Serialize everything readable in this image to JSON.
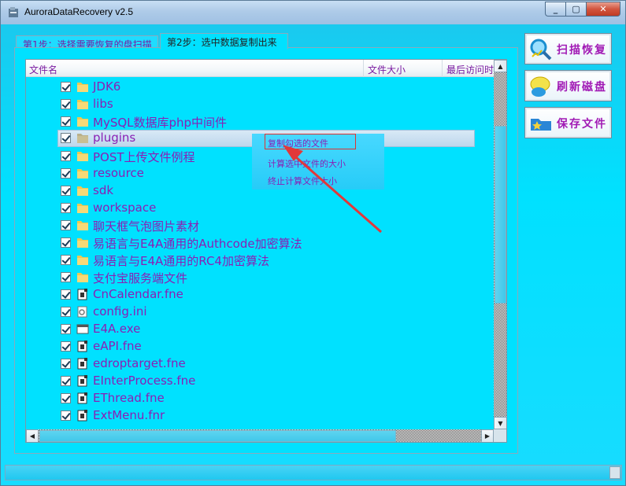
{
  "window": {
    "title": "AuroraDataRecovery v2.5",
    "min_label": "_",
    "max_label": "▢",
    "close_label": "✕"
  },
  "tabs": [
    {
      "label": "第1步：选择需要恢复的盘扫描"
    },
    {
      "label": "第2步：选中数据复制出来"
    }
  ],
  "list": {
    "columns": [
      "文件名",
      "文件大小",
      "最后访问时间"
    ],
    "rows": [
      {
        "name": "JDK6",
        "type": "folder"
      },
      {
        "name": "libs",
        "type": "folder"
      },
      {
        "name": "MySQL数据库php中间件",
        "type": "folder"
      },
      {
        "name": "plugins",
        "type": "folder"
      },
      {
        "name": "POST上传文件例程",
        "type": "folder"
      },
      {
        "name": "resource",
        "type": "folder"
      },
      {
        "name": "sdk",
        "type": "folder"
      },
      {
        "name": "workspace",
        "type": "folder"
      },
      {
        "name": "聊天框气泡图片素材",
        "type": "folder"
      },
      {
        "name": "易语言与E4A通用的Authcode加密算法",
        "type": "folder"
      },
      {
        "name": "易语言与E4A通用的RC4加密算法",
        "type": "folder"
      },
      {
        "name": "支付宝服务端文件",
        "type": "folder"
      },
      {
        "name": "CnCalendar.fne",
        "type": "fne"
      },
      {
        "name": "config.ini",
        "type": "ini"
      },
      {
        "name": "E4A.exe",
        "type": "exe"
      },
      {
        "name": "eAPI.fne",
        "type": "fne"
      },
      {
        "name": "edroptarget.fne",
        "type": "fne"
      },
      {
        "name": "EInterProcess.fne",
        "type": "fne"
      },
      {
        "name": "EThread.fne",
        "type": "fne"
      },
      {
        "name": "ExtMenu.fnr",
        "type": "fne"
      }
    ]
  },
  "context_menu": {
    "items": [
      "复制勾选的文件",
      "计算选中文件的大小",
      "终止计算文件大小"
    ]
  },
  "side_buttons": [
    {
      "label": "扫描恢复",
      "icon": "magnifier-icon"
    },
    {
      "label": "刷新磁盘",
      "icon": "bubble-icon"
    },
    {
      "label": "保存文件",
      "icon": "folder-star-icon"
    }
  ],
  "colors": {
    "background": "#00e1ff",
    "text_purple": "#8a1fb5",
    "highlight_border": "#dd3333"
  }
}
